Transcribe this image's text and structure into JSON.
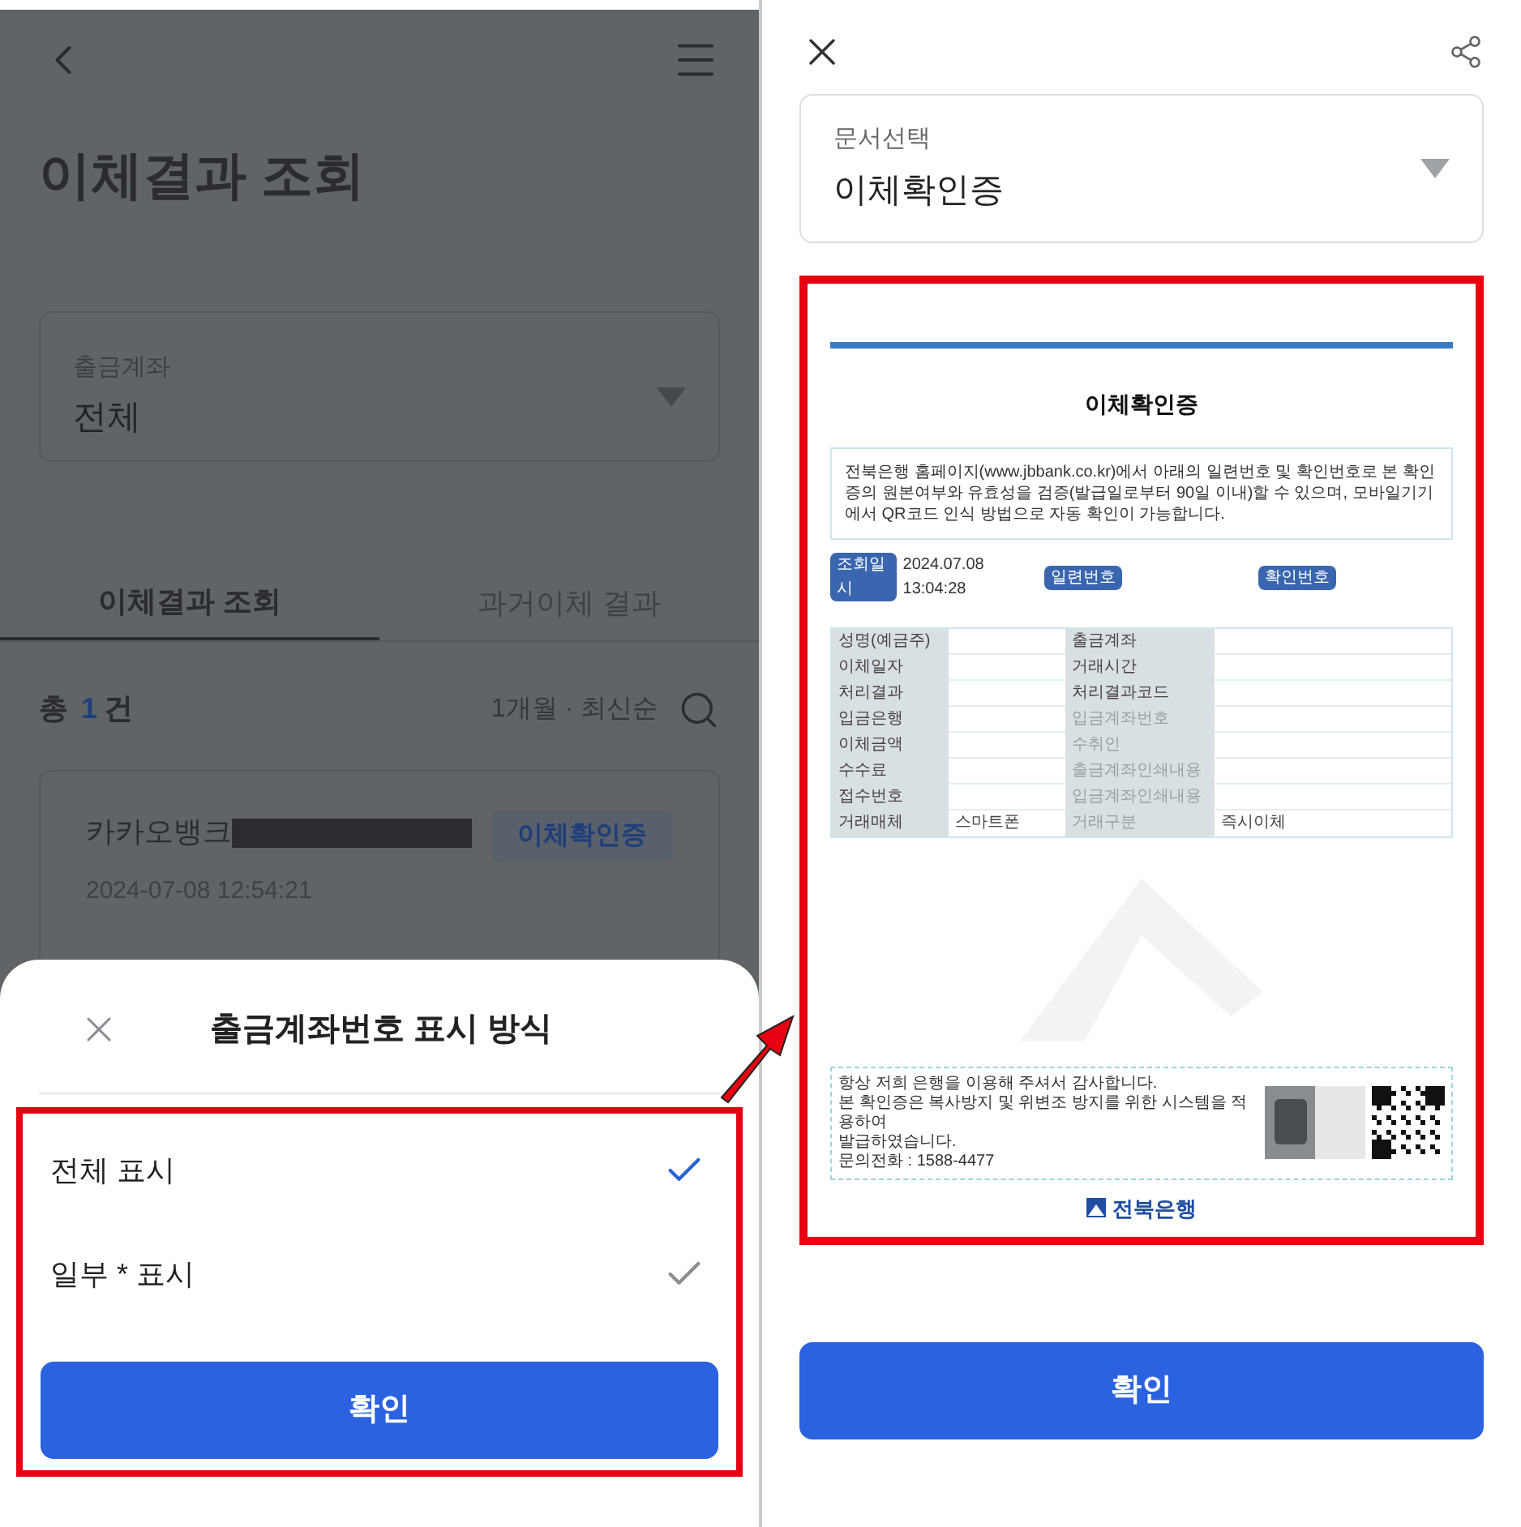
{
  "left_screen": {
    "title": "이체결과 조회",
    "account_select": {
      "label": "출금계좌",
      "value": "전체"
    },
    "tabs": [
      {
        "label": "이체결과 조회",
        "selected": true
      },
      {
        "label": "과거이체 결과",
        "selected": false
      }
    ],
    "total": {
      "prefix": "총",
      "count": "1",
      "suffix": "건"
    },
    "filter": "1개월 · 최신순",
    "transactions": [
      {
        "bank": "카카오뱅크",
        "masked": true,
        "datetime": "2024-07-08 12:54:21",
        "badge": "이체확인증"
      }
    ]
  },
  "bottom_sheet": {
    "title": "출금계좌번호 표시 방식",
    "options": [
      {
        "label": "전체 표시",
        "selected": true
      },
      {
        "label": "일부 * 표시",
        "selected": false
      }
    ],
    "confirm": "확인"
  },
  "right_screen": {
    "document_select": {
      "label": "문서선택",
      "value": "이체확인증"
    },
    "document": {
      "title": "이체확인증",
      "notice": "전북은행 홈페이지(www.jbbank.co.kr)에서 아래의 일련번호 및 확인번호로 본 확인증의 원본여부와 유효성을 검증(발급일로부터 90일 이내)할 수 있으며, 모바일기기 에서 QR코드 인식 방법으로  자동 확인이 가능합니다.",
      "meta": [
        {
          "label": "조회일시",
          "value": "2024.07.08 13:04:28"
        },
        {
          "label": "일련번호"
        },
        {
          "label": "확인번호"
        }
      ],
      "rows": [
        {
          "label": "성명(예금주)",
          "label_2": "출금계좌",
          "dimmed": false
        },
        {
          "label": "이체일자",
          "label_2": "거래시간",
          "dimmed": false
        },
        {
          "label": "처리결과",
          "label_2": "처리결과코드",
          "dimmed": false
        },
        {
          "label": "입금은행",
          "label_2": "입금계좌번호",
          "dimmed": true
        },
        {
          "label": "이체금액",
          "label_2": "수취인",
          "dimmed": true
        },
        {
          "label": "수수료",
          "label_2": "출금계좌인쇄내용",
          "dimmed": true
        },
        {
          "label": "접수번호",
          "label_2": "입금계좌인쇄내용",
          "dimmed": true
        },
        {
          "label": "거래매체",
          "value": "스마트폰",
          "label_2": "거래구분",
          "value_2": "즉시이체",
          "dimmed": true
        }
      ],
      "footer_lines": [
        "항상 저희 은행을 이용해 주셔서 감사합니다.",
        "본 확인증은 복사방지 및 위변조 방지를 위한 시스템을 적용하여",
        "발급하였습니다.",
        "문의전화 : 1588-4477"
      ],
      "bank_logo": "전북은행"
    },
    "confirm": "확인"
  }
}
